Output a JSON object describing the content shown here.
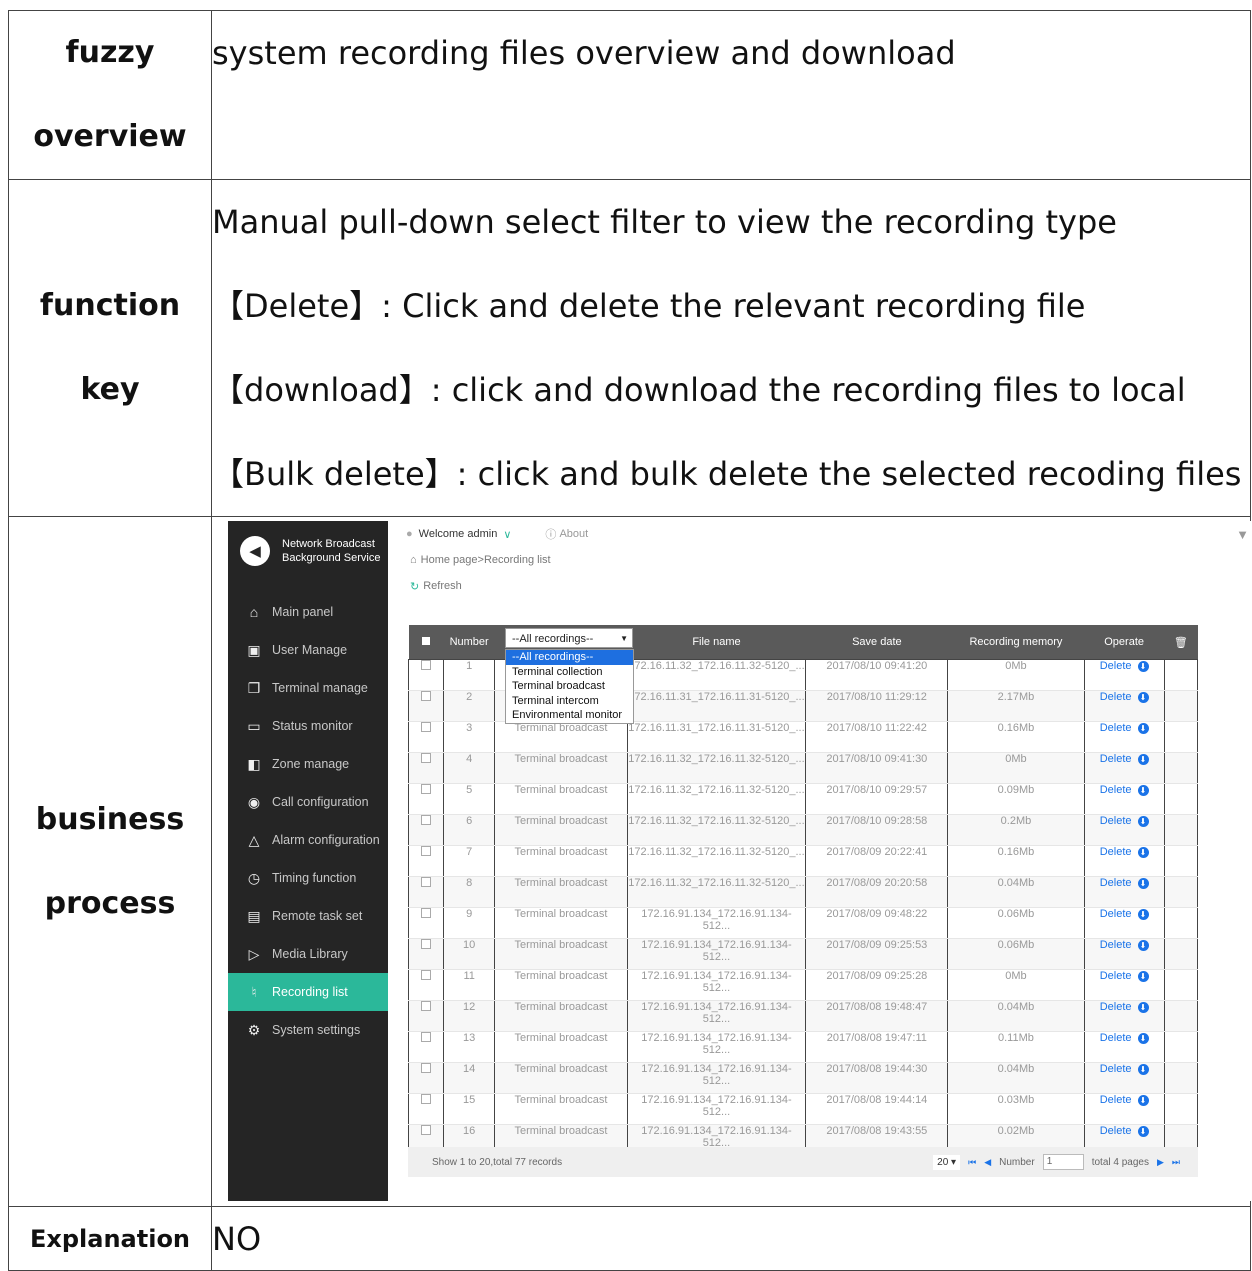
{
  "table": {
    "rows": [
      {
        "label_lines": [
          "fuzzy",
          "overview"
        ],
        "text_lines": [
          "system recording files overview and download"
        ]
      },
      {
        "label_lines": [
          "function",
          "key"
        ],
        "text_lines": [
          "Manual pull-down select filter to view the recording type",
          "【Delete】: Click and delete the relevant recording file",
          "【download】: click and download the recording files to local",
          "【Bulk delete】: click and bulk delete the selected recoding files"
        ]
      },
      {
        "label_lines": [
          "business",
          "process"
        ]
      },
      {
        "label_lines": [
          "Explanation"
        ],
        "text_lines": [
          "NO"
        ]
      }
    ]
  },
  "shot": {
    "brand": {
      "line1": "Network Broadcast",
      "line2": "Background Service"
    },
    "nav": [
      {
        "icon": "home-icon",
        "glyph": "⌂",
        "label": "Main panel"
      },
      {
        "icon": "user-icon",
        "glyph": "▣",
        "label": "User Manage"
      },
      {
        "icon": "terminal-icon",
        "glyph": "❐",
        "label": "Terminal manage"
      },
      {
        "icon": "monitor-icon",
        "glyph": "▭",
        "label": "Status monitor"
      },
      {
        "icon": "zone-icon",
        "glyph": "◧",
        "label": "Zone manage"
      },
      {
        "icon": "call-icon",
        "glyph": "◉",
        "label": "Call configuration"
      },
      {
        "icon": "alarm-icon",
        "glyph": "△",
        "label": "Alarm configuration"
      },
      {
        "icon": "timer-icon",
        "glyph": "◷",
        "label": "Timing function"
      },
      {
        "icon": "task-icon",
        "glyph": "▤",
        "label": "Remote task set"
      },
      {
        "icon": "media-icon",
        "glyph": "▷",
        "label": "Media Library"
      },
      {
        "icon": "recording-icon",
        "glyph": "♮",
        "label": "Recording list",
        "active": true
      },
      {
        "icon": "settings-icon",
        "glyph": "⚙",
        "label": "System settings"
      }
    ],
    "topbar": {
      "welcome": "Welcome",
      "user": "admin",
      "about": "About"
    },
    "breadcrumb": "Home page>Recording list",
    "refresh": "Refresh",
    "columns": {
      "number": "Number",
      "type_filter": "--All recordings--",
      "file": "File name",
      "date": "Save date",
      "memory": "Recording memory",
      "operate": "Operate"
    },
    "dropdown_options": [
      "--All recordings--",
      "Terminal collection",
      "Terminal broadcast",
      "Terminal intercom",
      "Environmental monitor"
    ],
    "delete_label": "Delete",
    "records": [
      {
        "n": "1",
        "type": "",
        "file": "172.16.11.32_172.16.11.32-5120_...",
        "date": "2017/08/10 09:41:20",
        "mem": "0Mb"
      },
      {
        "n": "2",
        "type": "",
        "file": "172.16.11.31_172.16.11.31-5120_...",
        "date": "2017/08/10 11:29:12",
        "mem": "2.17Mb"
      },
      {
        "n": "3",
        "type": "Terminal broadcast",
        "file": "172.16.11.31_172.16.11.31-5120_...",
        "date": "2017/08/10 11:22:42",
        "mem": "0.16Mb"
      },
      {
        "n": "4",
        "type": "Terminal broadcast",
        "file": "172.16.11.32_172.16.11.32-5120_...",
        "date": "2017/08/10 09:41:30",
        "mem": "0Mb"
      },
      {
        "n": "5",
        "type": "Terminal broadcast",
        "file": "172.16.11.32_172.16.11.32-5120_...",
        "date": "2017/08/10 09:29:57",
        "mem": "0.09Mb"
      },
      {
        "n": "6",
        "type": "Terminal broadcast",
        "file": "172.16.11.32_172.16.11.32-5120_...",
        "date": "2017/08/10 09:28:58",
        "mem": "0.2Mb"
      },
      {
        "n": "7",
        "type": "Terminal broadcast",
        "file": "172.16.11.32_172.16.11.32-5120_...",
        "date": "2017/08/09 20:22:41",
        "mem": "0.16Mb"
      },
      {
        "n": "8",
        "type": "Terminal broadcast",
        "file": "172.16.11.32_172.16.11.32-5120_...",
        "date": "2017/08/09 20:20:58",
        "mem": "0.04Mb"
      },
      {
        "n": "9",
        "type": "Terminal broadcast",
        "file": "172.16.91.134_172.16.91.134-512...",
        "date": "2017/08/09 09:48:22",
        "mem": "0.06Mb"
      },
      {
        "n": "10",
        "type": "Terminal broadcast",
        "file": "172.16.91.134_172.16.91.134-512...",
        "date": "2017/08/09 09:25:53",
        "mem": "0.06Mb"
      },
      {
        "n": "11",
        "type": "Terminal broadcast",
        "file": "172.16.91.134_172.16.91.134-512...",
        "date": "2017/08/09 09:25:28",
        "mem": "0Mb"
      },
      {
        "n": "12",
        "type": "Terminal broadcast",
        "file": "172.16.91.134_172.16.91.134-512...",
        "date": "2017/08/08 19:48:47",
        "mem": "0.04Mb"
      },
      {
        "n": "13",
        "type": "Terminal broadcast",
        "file": "172.16.91.134_172.16.91.134-512...",
        "date": "2017/08/08 19:47:11",
        "mem": "0.11Mb"
      },
      {
        "n": "14",
        "type": "Terminal broadcast",
        "file": "172.16.91.134_172.16.91.134-512...",
        "date": "2017/08/08 19:44:30",
        "mem": "0.04Mb"
      },
      {
        "n": "15",
        "type": "Terminal broadcast",
        "file": "172.16.91.134_172.16.91.134-512...",
        "date": "2017/08/08 19:44:14",
        "mem": "0.03Mb"
      },
      {
        "n": "16",
        "type": "Terminal broadcast",
        "file": "172.16.91.134_172.16.91.134-512...",
        "date": "2017/08/08 19:43:55",
        "mem": "0.02Mb"
      }
    ],
    "footer": {
      "summary": "Show 1 to 20,total 77 records",
      "page_size": "20",
      "page_label": "Number",
      "page_value": "1",
      "total_pages": "total 4 pages"
    },
    "colors": {
      "sidebar": "#252525",
      "active": "#2bb89a",
      "link": "#1a73e8",
      "header": "#5a5a5a"
    }
  }
}
